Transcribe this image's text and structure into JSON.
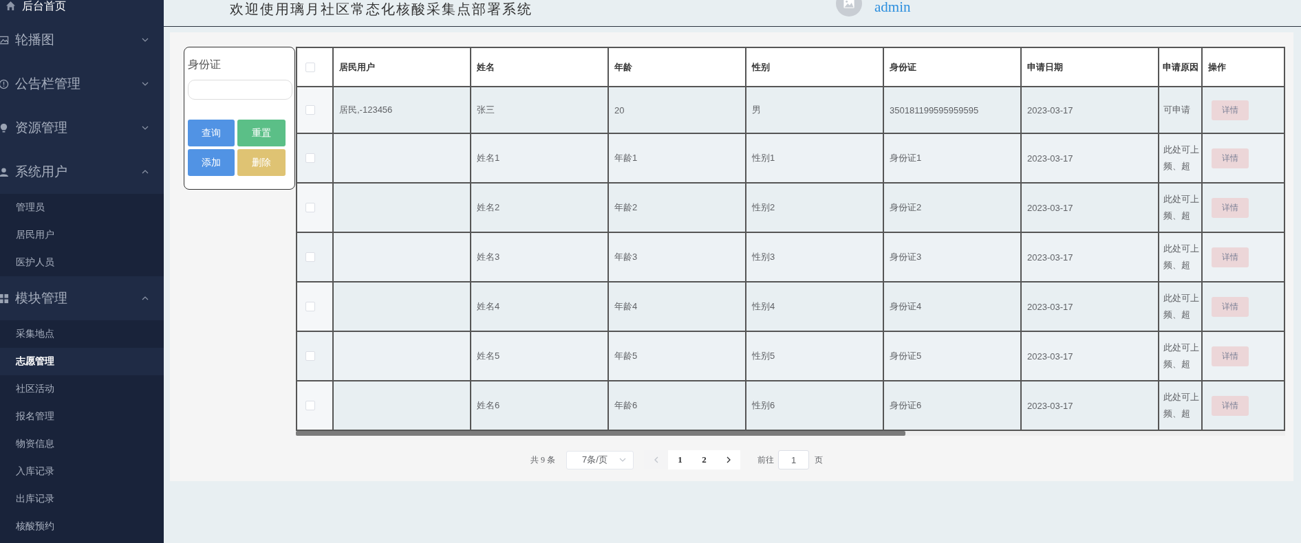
{
  "sidebar": {
    "home": {
      "label": "后台首页"
    },
    "groups": [
      {
        "label": "轮播图",
        "expanded": false
      },
      {
        "label": "公告栏管理",
        "expanded": false
      },
      {
        "label": "资源管理",
        "expanded": false
      },
      {
        "label": "系统用户",
        "expanded": true,
        "children": [
          {
            "label": "管理员",
            "selected": false
          },
          {
            "label": "居民用户",
            "selected": false
          },
          {
            "label": "医护人员",
            "selected": false
          }
        ]
      },
      {
        "label": "模块管理",
        "expanded": true,
        "children": [
          {
            "label": "采集地点",
            "selected": false
          },
          {
            "label": "志愿管理",
            "selected": true
          },
          {
            "label": "社区活动",
            "selected": false
          },
          {
            "label": "报名管理",
            "selected": false
          },
          {
            "label": "物资信息",
            "selected": false
          },
          {
            "label": "入库记录",
            "selected": false
          },
          {
            "label": "出库记录",
            "selected": false
          },
          {
            "label": "核酸预约",
            "selected": false
          }
        ]
      }
    ]
  },
  "header": {
    "title": "欢迎使用璃月社区常态化核酸采集点部署系统",
    "user": "admin"
  },
  "search": {
    "label": "身份证",
    "buttons": [
      {
        "label": "查询",
        "color": "#5193e4"
      },
      {
        "label": "重置",
        "color": "#5bbf87"
      },
      {
        "label": "添加",
        "color": "#5193e4"
      },
      {
        "label": "删除",
        "color": "#dfc373"
      }
    ]
  },
  "table": {
    "select_all_checked": false,
    "columns": [
      "居民用户",
      "姓名",
      "年龄",
      "性别",
      "身份证",
      "申请日期",
      "申请原因",
      "操作"
    ],
    "rows": [
      {
        "checked": false,
        "cells": [
          "居民,-123456",
          "张三",
          "20",
          "男",
          "350181199595959595",
          "2023-03-17"
        ],
        "reason_lines": [
          "可申请"
        ],
        "action": "详情"
      },
      {
        "checked": false,
        "cells": [
          "",
          "姓名1",
          "年龄1",
          "性别1",
          "身份证1",
          "2023-03-17"
        ],
        "reason_lines": [
          "此处可上",
          "频、超"
        ],
        "action": "详情"
      },
      {
        "checked": false,
        "cells": [
          "",
          "姓名2",
          "年龄2",
          "性别2",
          "身份证2",
          "2023-03-17"
        ],
        "reason_lines": [
          "此处可上",
          "频、超"
        ],
        "action": "详情"
      },
      {
        "checked": false,
        "cells": [
          "",
          "姓名3",
          "年龄3",
          "性别3",
          "身份证3",
          "2023-03-17"
        ],
        "reason_lines": [
          "此处可上",
          "频、超"
        ],
        "action": "详情"
      },
      {
        "checked": false,
        "cells": [
          "",
          "姓名4",
          "年龄4",
          "性别4",
          "身份证4",
          "2023-03-17"
        ],
        "reason_lines": [
          "此处可上",
          "频、超"
        ],
        "action": "详情"
      },
      {
        "checked": false,
        "cells": [
          "",
          "姓名5",
          "年龄5",
          "性别5",
          "身份证5",
          "2023-03-17"
        ],
        "reason_lines": [
          "此处可上",
          "频、超"
        ],
        "action": "详情"
      },
      {
        "checked": false,
        "cells": [
          "",
          "姓名6",
          "年龄6",
          "性别6",
          "身份证6",
          "2023-03-17"
        ],
        "reason_lines": [
          "此处可上",
          "频、超"
        ],
        "action": "详情"
      }
    ]
  },
  "pagination": {
    "total": "共 9 条",
    "page_size": "7条/页",
    "prev_disabled": true,
    "next_disabled": false,
    "pages": [
      "1",
      "2"
    ],
    "goto_label": "前往",
    "goto_value": "1",
    "goto_suffix": "页"
  }
}
